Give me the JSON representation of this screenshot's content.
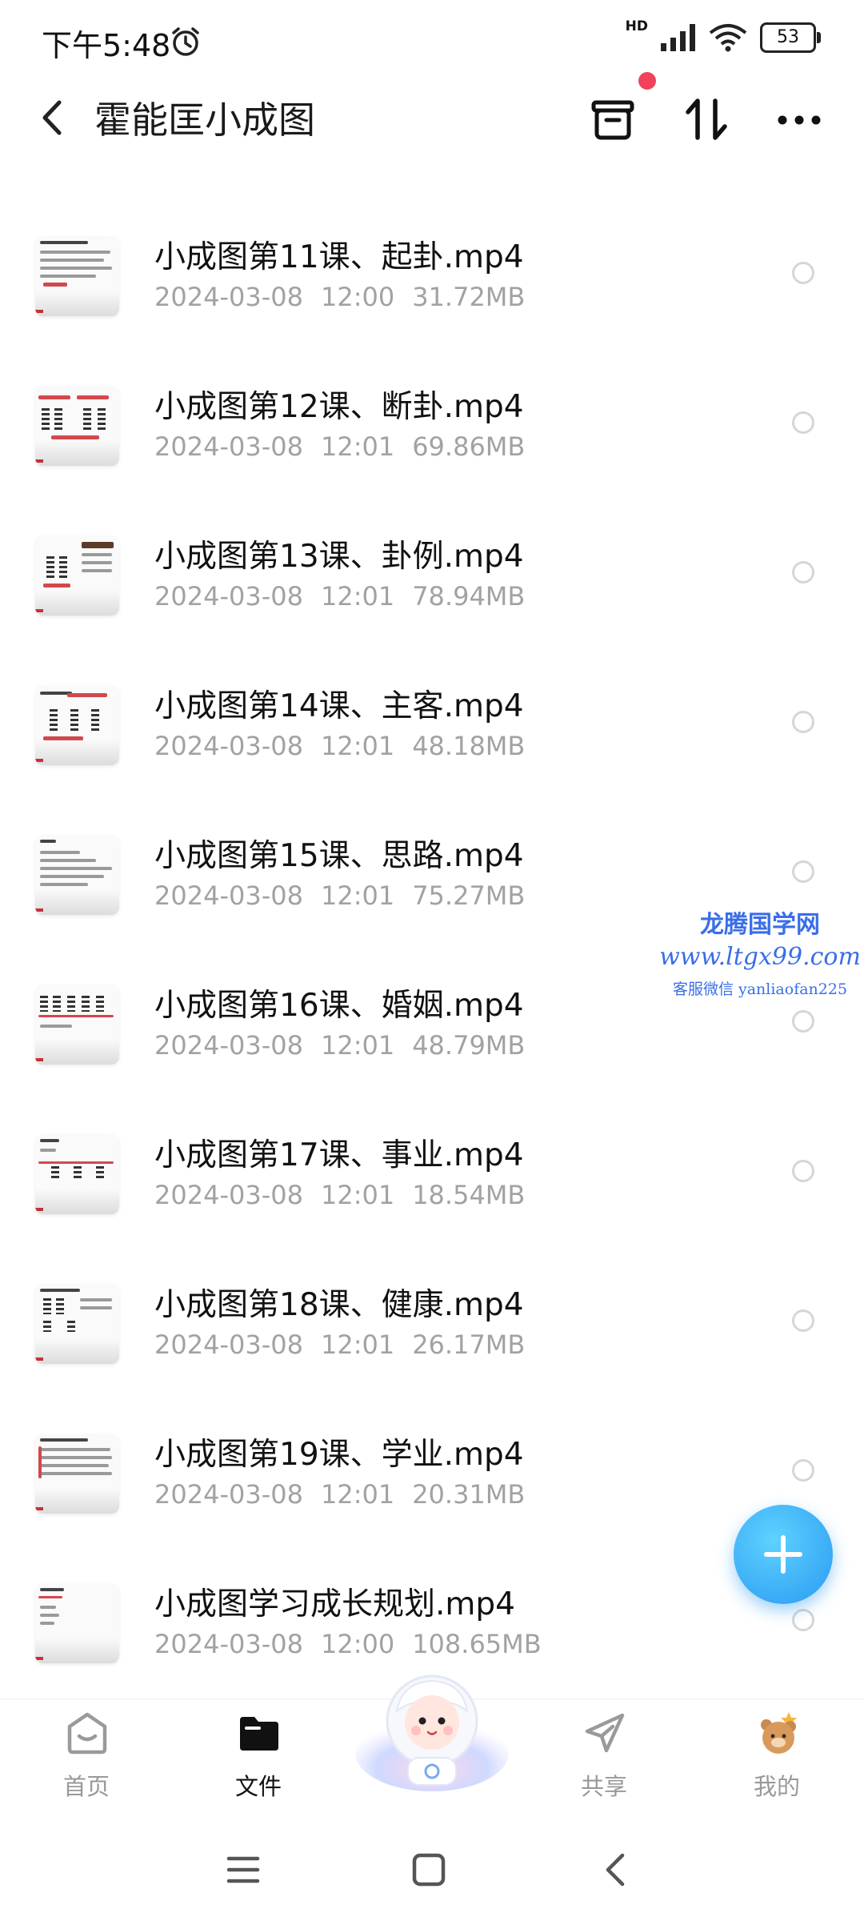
{
  "status_bar": {
    "time": "下午5:48",
    "network": "HD",
    "battery": "53"
  },
  "header": {
    "title": "霍能匡小成图"
  },
  "files": [
    {
      "name": "小成图第11课、起卦.mp4",
      "date": "2024-03-08",
      "time": "12:00",
      "size": "31.72MB"
    },
    {
      "name": "小成图第12课、断卦.mp4",
      "date": "2024-03-08",
      "time": "12:01",
      "size": "69.86MB"
    },
    {
      "name": "小成图第13课、卦例.mp4",
      "date": "2024-03-08",
      "time": "12:01",
      "size": "78.94MB"
    },
    {
      "name": "小成图第14课、主客.mp4",
      "date": "2024-03-08",
      "time": "12:01",
      "size": "48.18MB"
    },
    {
      "name": "小成图第15课、思路.mp4",
      "date": "2024-03-08",
      "time": "12:01",
      "size": "75.27MB"
    },
    {
      "name": "小成图第16课、婚姻.mp4",
      "date": "2024-03-08",
      "time": "12:01",
      "size": "48.79MB"
    },
    {
      "name": "小成图第17课、事业.mp4",
      "date": "2024-03-08",
      "time": "12:01",
      "size": "18.54MB"
    },
    {
      "name": "小成图第18课、健康.mp4",
      "date": "2024-03-08",
      "time": "12:01",
      "size": "26.17MB"
    },
    {
      "name": "小成图第19课、学业.mp4",
      "date": "2024-03-08",
      "time": "12:01",
      "size": "20.31MB"
    },
    {
      "name": "小成图学习成长规划.mp4",
      "date": "2024-03-08",
      "time": "12:00",
      "size": "108.65MB"
    }
  ],
  "watermark": {
    "line1": "龙腾国学网",
    "line2": "www.ltgx99.com",
    "line3": "客服微信 yanliaofan225"
  },
  "bottom_nav": {
    "home": "首页",
    "files": "文件",
    "share": "共享",
    "mine": "我的"
  },
  "colors": {
    "accent": "#2a9af2",
    "badge": "#f0425a",
    "watermark": "#3a6ee8"
  }
}
